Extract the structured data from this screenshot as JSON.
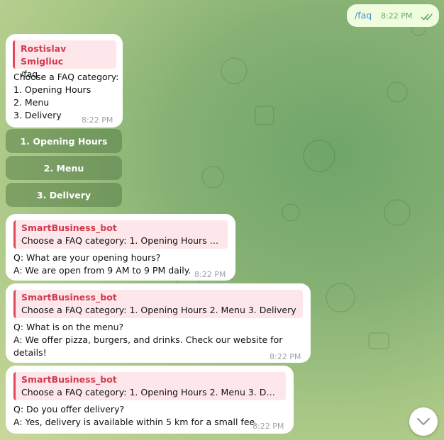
{
  "outgoing": {
    "text": "/faq",
    "time": "8:22 PM"
  },
  "user_msg": {
    "sender": "Rostislav Smigliuc",
    "command": "/faq",
    "lines": [
      "Choose a FAQ category:",
      "1. Opening Hours",
      "2. Menu",
      "3. Delivery"
    ],
    "time": "8:22 PM"
  },
  "keyboard": [
    "1. Opening Hours",
    "2. Menu",
    "3. Delivery"
  ],
  "replies": [
    {
      "reply_name": "SmartBusiness_bot",
      "reply_text": "Choose a FAQ category: 1. Opening Hours 2. ...",
      "q": "Q: What are your opening hours?",
      "a": "A: We are open from 9 AM to 9 PM daily.",
      "time": "8:22 PM"
    },
    {
      "reply_name": "SmartBusiness_bot",
      "reply_text": "Choose a FAQ category: 1. Opening Hours 2. Menu 3. Delivery",
      "q": "Q: What is on the menu?",
      "a1": "A: We offer pizza, burgers, and drinks. Check our website for",
      "a2": "details!",
      "time": "8:22 PM"
    },
    {
      "reply_name": "SmartBusiness_bot",
      "reply_text": "Choose a FAQ category: 1. Opening Hours 2. Menu 3. Deliv...",
      "q": "Q: Do you offer delivery?",
      "a": "A: Yes, delivery is available within 5 km for a small fee.",
      "time": "8:22 PM"
    }
  ],
  "icons": {
    "read_receipt": "double-check-icon",
    "scroll_down": "chevron-down-icon"
  },
  "colors": {
    "sender_name": "#d23a4f",
    "outgoing_bubble": "#effdde",
    "link": "#3a8fd6"
  }
}
